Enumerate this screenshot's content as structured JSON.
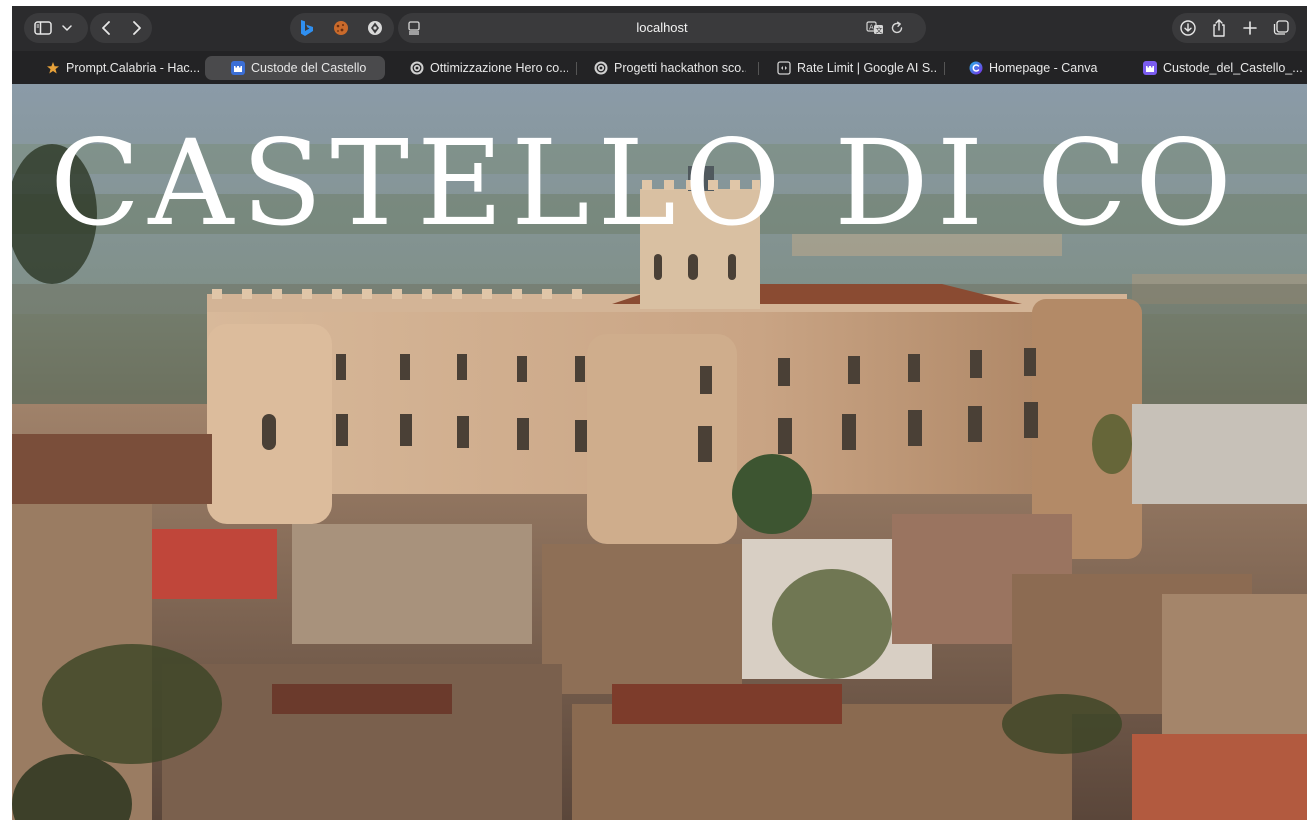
{
  "browser": {
    "address": "localhost"
  },
  "tabs": [
    {
      "label": "Prompt.Calabria - Hac...",
      "active": false,
      "favicon": "star-icon",
      "color": "#e8a23a"
    },
    {
      "label": "Custode del Castello",
      "active": true,
      "favicon": "castle-icon",
      "color": "#3b6fd6"
    },
    {
      "label": "Ottimizzazione Hero co...",
      "active": false,
      "favicon": "openai-icon",
      "color": "#d0d0d0"
    },
    {
      "label": "Progetti hackathon sco...",
      "active": false,
      "favicon": "openai-icon",
      "color": "#d0d0d0"
    },
    {
      "label": "Rate Limit | Google AI S...",
      "active": false,
      "favicon": "google-ai-icon",
      "color": "#d0d0d0"
    },
    {
      "label": "Homepage - Canva",
      "active": false,
      "favicon": "canva-icon",
      "color": "#24b7e6"
    },
    {
      "label": "Custode_del_Castello_...",
      "active": false,
      "favicon": "castle-icon",
      "color": "#7b5cf0"
    }
  ],
  "hero": {
    "title": "CASTELLO DI CO",
    "image": "corigliano-castle-photo"
  }
}
